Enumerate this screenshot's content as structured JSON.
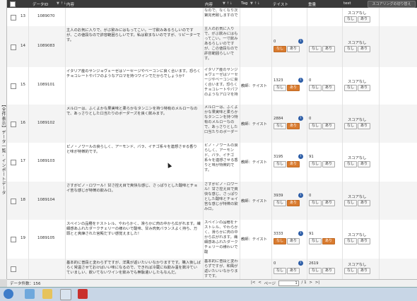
{
  "sidebar": {
    "label": "【全件表示】データ一覧 - インポートデータ"
  },
  "header": {
    "col_id": "データID",
    "col_content": "内容",
    "col_content2": "内容",
    "col_tag": "Tag",
    "col_t1": "テイスト",
    "col_t2": "重量",
    "col_t3": "test",
    "sort_mark": "▼ ↑↓",
    "right_button": "スコアリングの切り替え"
  },
  "rows": [
    {
      "no": "13",
      "id": "1089070",
      "text": "",
      "note": "なので、なくなり次第完売致しますので",
      "tag": "",
      "s1": "",
      "s2": "",
      "r3": "スコアなし",
      "sel1": "",
      "sel2": "",
      "sel3": ""
    },
    {
      "no": "14",
      "id": "1089083",
      "text": "主人のお気に入りで、がぶ飲みにはもってこい。一寸飲みあるらしいのですが、この値段なので許容範囲らしいです。私は飲まないのですが、リピーターです。",
      "note": "主人のお気に入りで、がぶ飲みにはもってこい。一寸飲みあるらしいのですが、この値段なので許容範囲らしいです。",
      "tag": "",
      "s1": "0",
      "s2": "",
      "r3": "スコアなし",
      "sel1": "なし",
      "sel2": "",
      "sel3": ""
    },
    {
      "no": "15",
      "id": "1089101",
      "text": "イタリア産のサンジョヴェーゼはソーセージやベーコンに良く合います。恐らくチョコレートやパフのようなアロマを持つワインでだからでしょうか?",
      "note": "イタリア産のサンジョヴェーゼはソーセージやベーコンに良く合います。恐らくチョコレートやパフのようなアロマを持",
      "tag": "教師：テイスト",
      "s1": "1323",
      "s2": "0",
      "r3": "スコアなし",
      "sel1": "あり",
      "sel2": "",
      "sel3": ""
    },
    {
      "no": "16",
      "id": "1089102",
      "text": "メルローは、ふくよかな果実味と柔らかなタンニンを持つ特有のメルローなので、あっさりとした口当たりのボーダーズを良く飲みます。",
      "note": "メルローは、ふくよかな果実味と柔らかなタンニンを持つ特有のメルローなので、あっさりとした口当たりのボーダー",
      "tag": "教師：テイスト",
      "s1": "2884",
      "s2": "0",
      "r3": "スコアなし",
      "sel1": "あり",
      "sel2": "",
      "sel3": ""
    },
    {
      "no": "17",
      "id": "1089103",
      "text": "ピノ・ノワールの良らしく、アーモンド、バラ、イチゴ系々を連想させる香りと味が特徴的です。",
      "note": "ピノ・ノワールの良らしく、アーモンド、バラ、イチゴ系々を連想させる香りと味が特徴的です。",
      "tag": "教師：テイスト",
      "s1": "3195",
      "s2": "91",
      "r3": "スコアなし",
      "sel1": "あり",
      "sel2": "",
      "sel3": ""
    },
    {
      "no": "18",
      "id": "1089104",
      "text": "さすがピノ・ロワール！甘さ控え目で爽快な感じ、さっぱりとした酸味とチョイ苦な感じが特徴の飲み口。",
      "note": "さすがピノ・ロワール！甘さ控え目で爽快な感じ、さっぱりとした酸味とチョイ苦な感じが特徴の飲み口。",
      "tag": "教師：テイスト",
      "s1": "3939",
      "s2": "0",
      "r3": "スコアなし",
      "sel1": "あり",
      "sel2": "",
      "sel3": ""
    },
    {
      "no": "19",
      "id": "1089105",
      "text": "スペインの品種をナストレル、やわらかく、滑らかに肉の中から広がれます。繊細感あふれたダークチェリーの様わいで酸味、甘み肉気バランスよく持ち、万頭とと爽練された宮殿だすい感覚えました！",
      "note": "スペインの品種をナストレル、やわらかく、滑らかに肉の中から広がれます。繊細感あふれたダークチェリーの様わいで酸",
      "tag": "教師：テイスト",
      "s1": "3333",
      "s2": "91",
      "r3": "スコアなし",
      "sel1": "なし",
      "sel2": "あり",
      "sel3": ""
    },
    {
      "no": "",
      "id": "",
      "text": "基本的に普段と変わらずですが、洋風が返いたいいなかりますです。購入後しばらく常温させておけばいい味になるので、できれば冷蔵にね飲み温を数冷ていていましい、飲いてないワインを飲みでも無駄遣いしたもなんだ。",
      "note": "基本的に普段と変わらずですが、和風が返いたいいなかりますです。",
      "tag": "",
      "s1": "0",
      "s2": "2619",
      "r3": "スコアなし",
      "sel1": "",
      "sel2": "",
      "sel3": ""
    }
  ],
  "labels": {
    "none": "なし",
    "yes": "あり"
  },
  "footer": {
    "count": "データ件数：156",
    "page_label": "ページ",
    "page_value": "1",
    "page_total": "/ 1",
    "first": "|<",
    "prev": "<",
    "next": ">",
    "last": ">|"
  },
  "colors": {
    "header_bg": "#3a3a3a",
    "selected": "#d97b2f",
    "icon": "#2f5fa8"
  }
}
